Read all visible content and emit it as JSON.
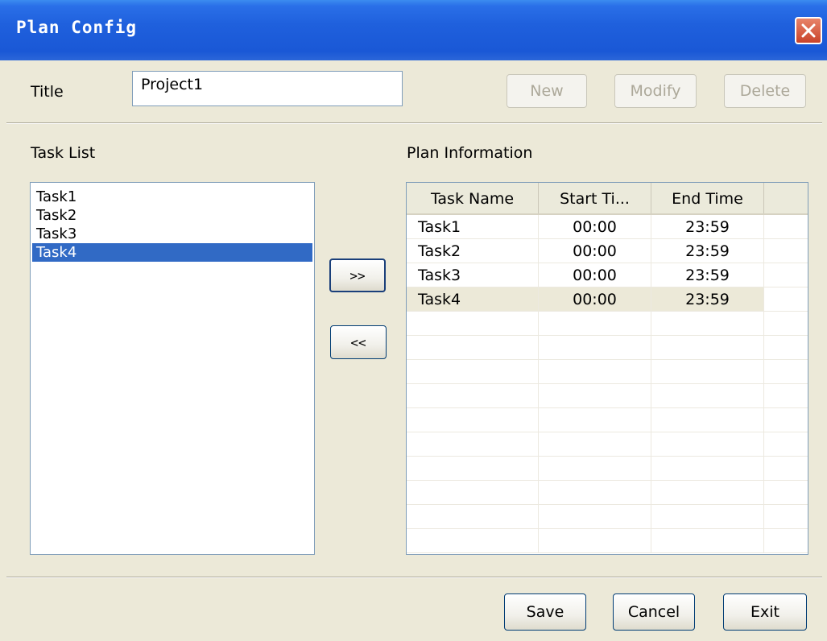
{
  "window": {
    "title": "Plan Config"
  },
  "title_field": {
    "label": "Title",
    "value": "Project1"
  },
  "toolbar": {
    "new_label": "New",
    "modify_label": "Modify",
    "delete_label": "Delete"
  },
  "task_list": {
    "label": "Task List",
    "items": [
      "Task1",
      "Task2",
      "Task3",
      "Task4"
    ],
    "selected_index": 3
  },
  "move": {
    "add_label": ">>",
    "remove_label": "<<"
  },
  "plan_info": {
    "label": "Plan Information",
    "columns": [
      "Task Name",
      "Start Ti...",
      "End Time"
    ],
    "rows": [
      [
        "Task1",
        "00:00",
        "23:59"
      ],
      [
        "Task2",
        "00:00",
        "23:59"
      ],
      [
        "Task3",
        "00:00",
        "23:59"
      ],
      [
        "Task4",
        "00:00",
        "23:59"
      ]
    ],
    "selected_index": 3
  },
  "footer": {
    "save_label": "Save",
    "cancel_label": "Cancel",
    "exit_label": "Exit"
  },
  "colors": {
    "titlebar": "#1f60dd",
    "selection": "#316ac5",
    "window_bg": "#ece9d8"
  }
}
